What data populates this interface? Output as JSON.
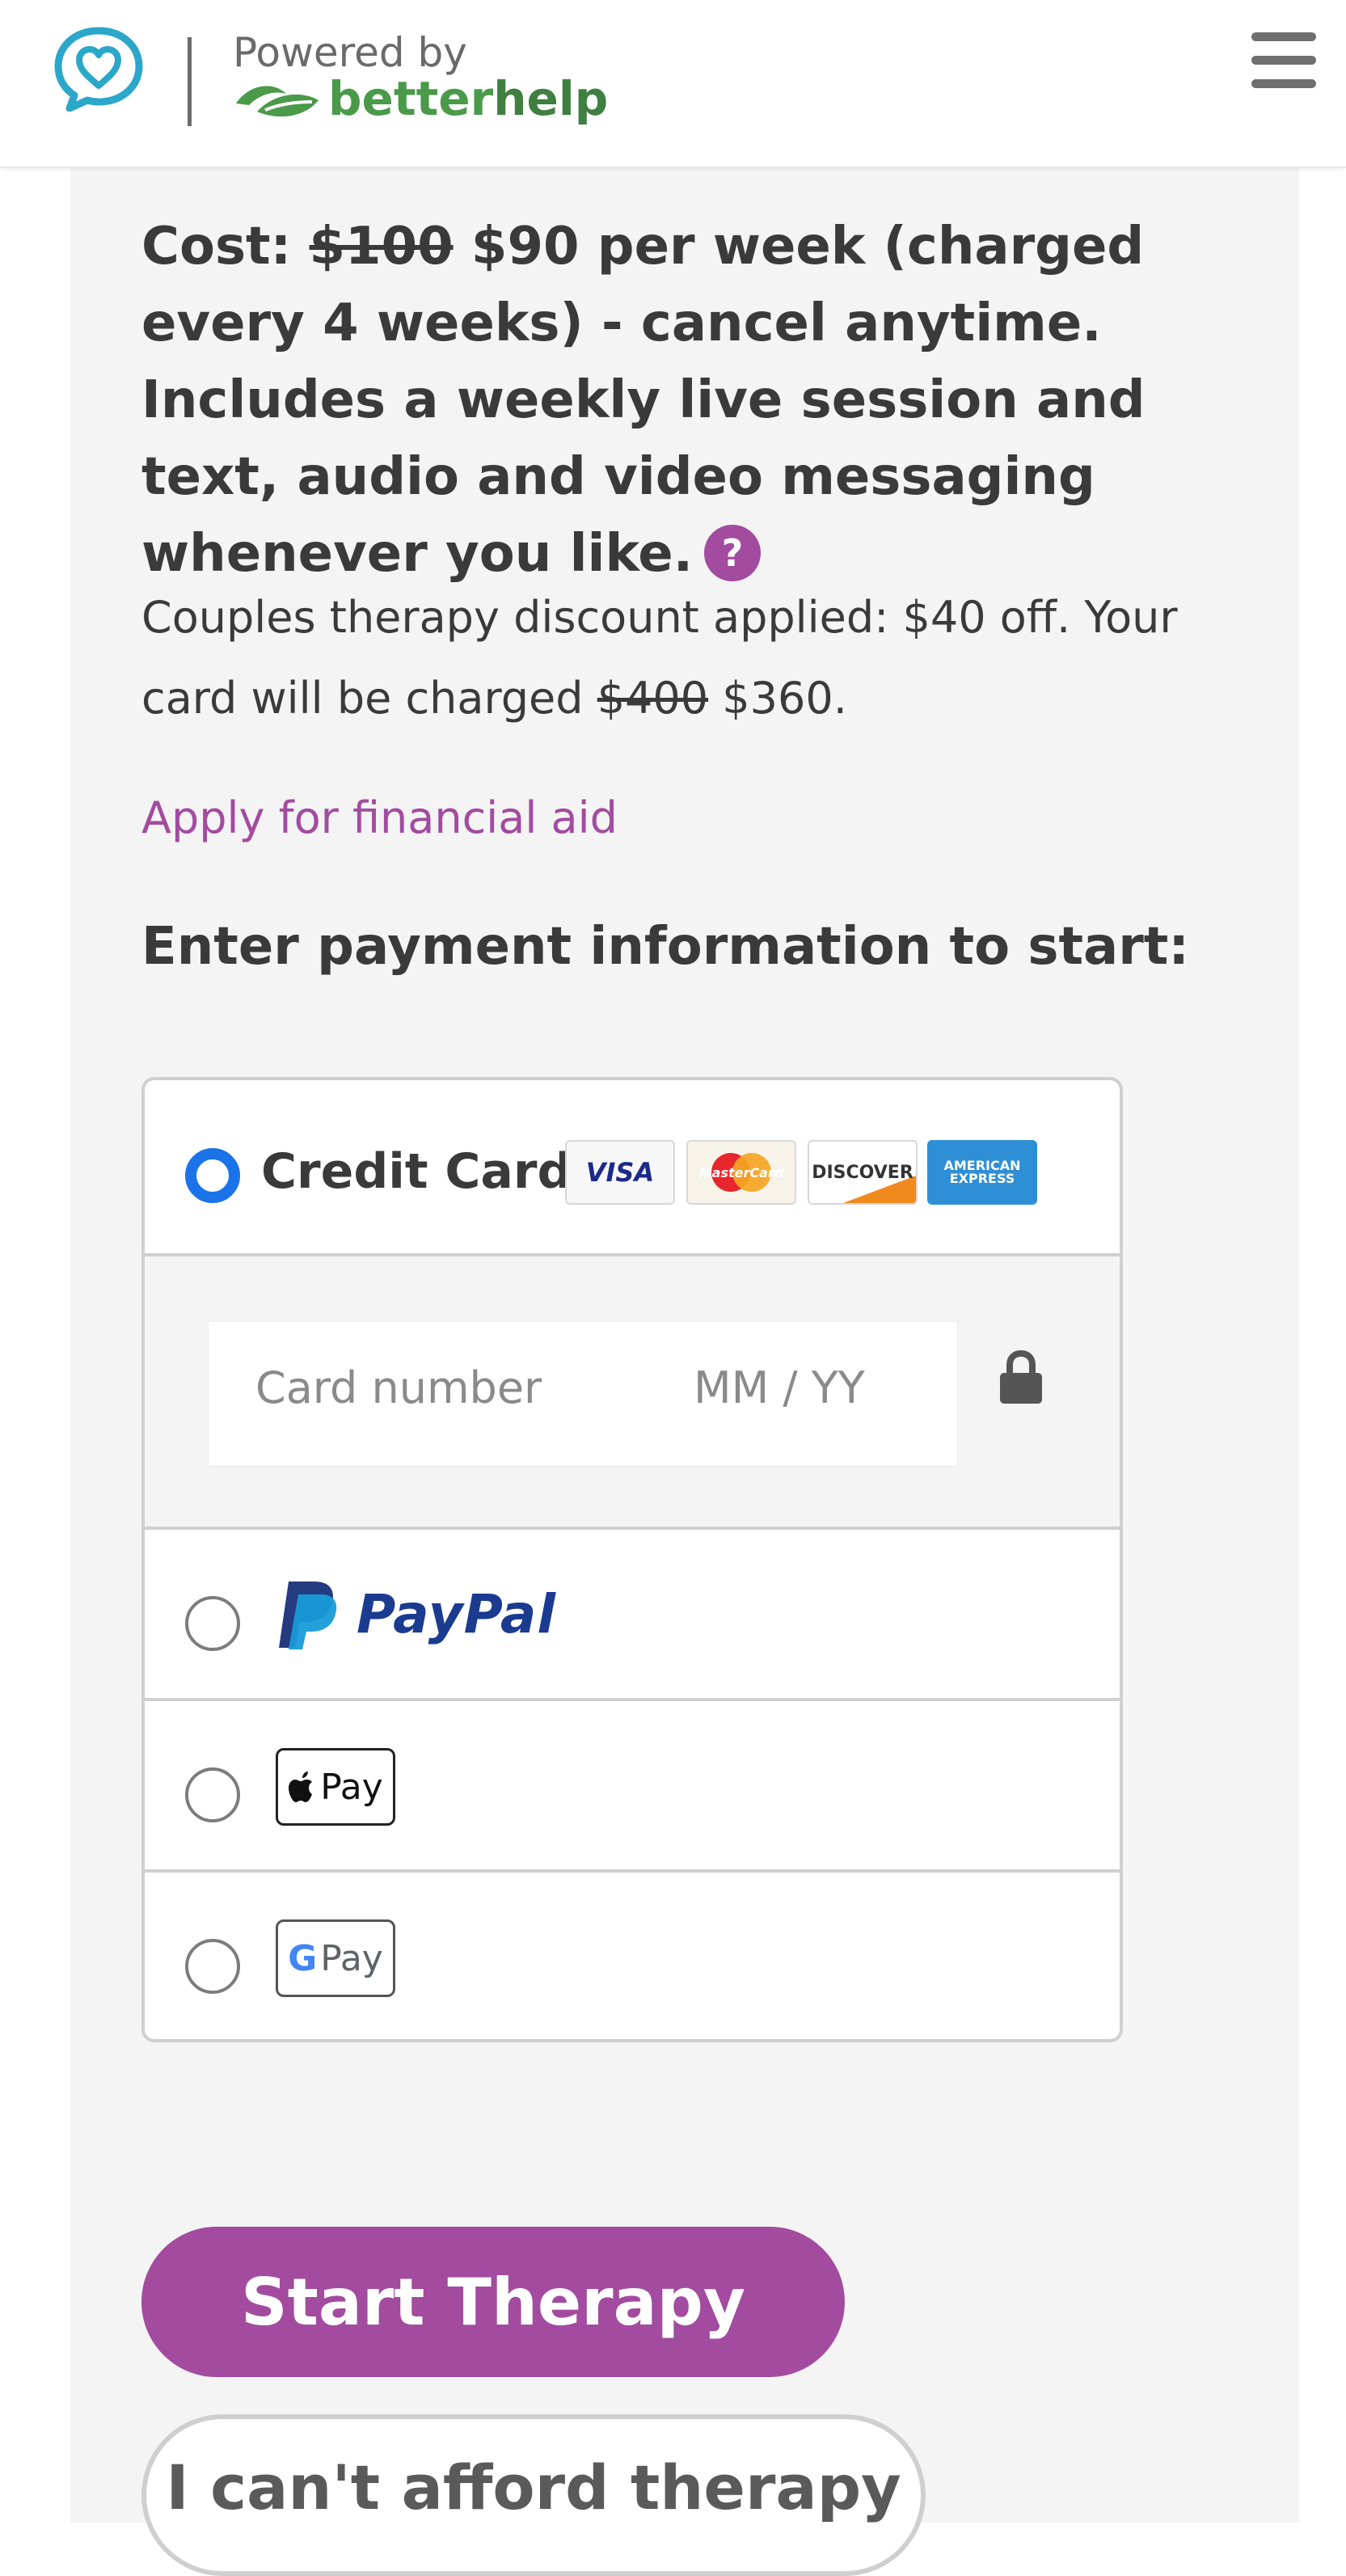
{
  "header": {
    "powered_by": "Powered by",
    "brand_part1": "better",
    "brand_part2": "help"
  },
  "cost": {
    "prefix": "Cost:",
    "old_price": "$100",
    "text": "$90 per week (charged every 4 weeks) - cancel anytime. Includes a weekly live session and text, audio and video messaging whenever you like.",
    "help_icon": "?"
  },
  "discount": {
    "text": "Couples therapy discount applied: $40 off. Your card will be charged",
    "old_amount": "$400",
    "new_amount": "$360."
  },
  "financial_aid_link": "Apply for financial aid",
  "payment_title": "Enter payment information to start:",
  "payment": {
    "credit_card_label": "Credit Card",
    "card_brands": {
      "visa": "VISA",
      "mastercard": "MasterCard",
      "discover": "DISCOVER",
      "amex_line1": "AMERICAN",
      "amex_line2": "EXPRESS"
    },
    "card_number_placeholder": "Card number",
    "expiry_placeholder": "MM / YY",
    "paypal_label": "PayPal",
    "apple_pay_label": "Pay",
    "google_pay_label": "Pay",
    "google_g": "G"
  },
  "buttons": {
    "start": "Start Therapy",
    "cant_afford": "I can't afford therapy"
  },
  "colors": {
    "accent": "#a24b9f",
    "radio_selected": "#1a73e8",
    "logo_teal": "#2aa7c9",
    "brand_green": "#4a9a4a"
  },
  "icons": [
    "heart-chat-logo-icon",
    "leaf-icon",
    "menu-icon",
    "question-icon",
    "lock-icon",
    "paypal-icon",
    "apple-icon",
    "google-icon"
  ]
}
